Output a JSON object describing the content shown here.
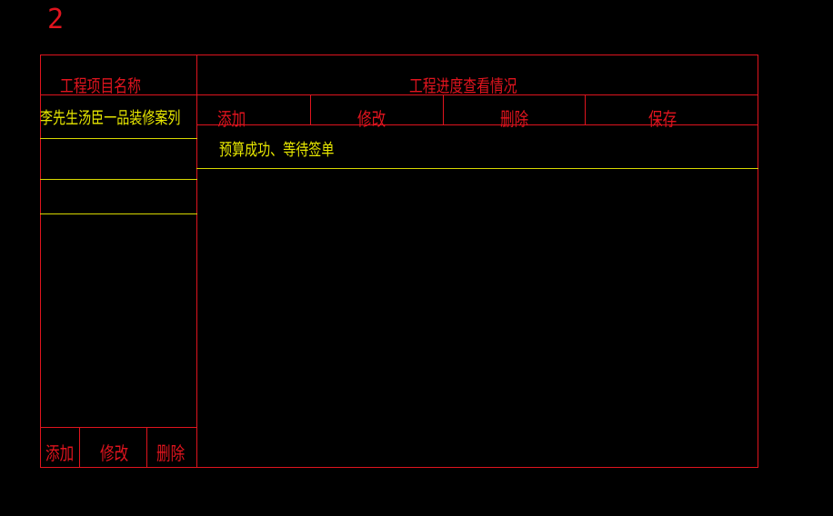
{
  "page_number": "2",
  "left_panel": {
    "header": "工程项目名称",
    "items": [
      "李先生汤臣一品装修案列",
      "",
      ""
    ],
    "buttons": [
      "添加",
      "修改",
      "删除"
    ]
  },
  "right_panel": {
    "header": "工程进度查看情况",
    "toolbar": [
      "添加",
      "修改",
      "删除",
      "保存"
    ],
    "rows": [
      "预算成功、等待签单"
    ]
  },
  "colors": {
    "border": "#e0141e",
    "highlight": "#e8e800",
    "background": "#000000"
  }
}
